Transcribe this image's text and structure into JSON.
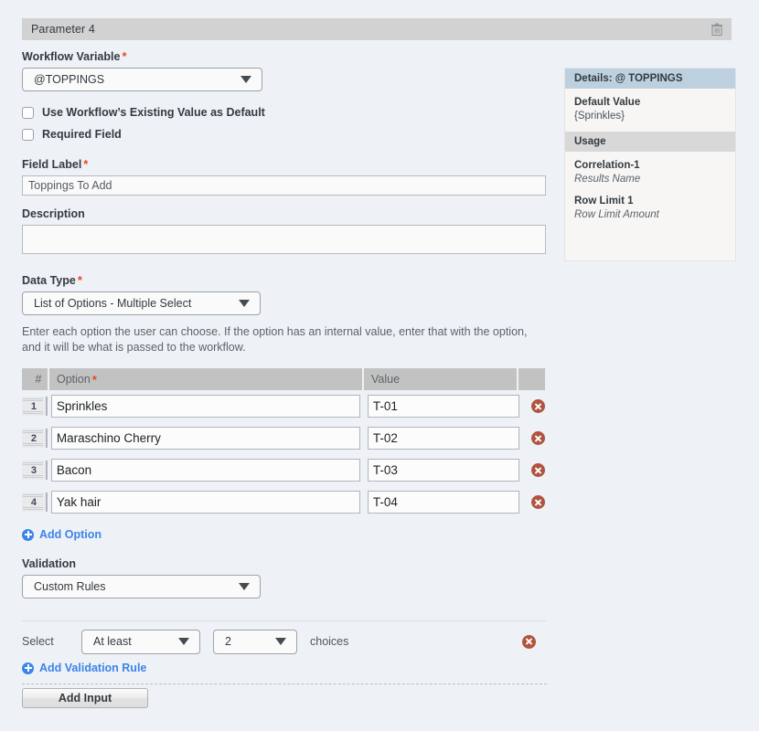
{
  "param_header": {
    "title": "Parameter 4",
    "delete_icon": "trash-icon"
  },
  "form": {
    "workflow_variable": {
      "label": "Workflow Variable",
      "required_marker": "*",
      "value": "@TOPPINGS"
    },
    "checkboxes": [
      {
        "label": "Use Workflow’s Existing Value as Default",
        "checked": false
      },
      {
        "label": "Required Field",
        "checked": false
      }
    ],
    "field_label": {
      "label": "Field Label",
      "required_marker": "*",
      "value": "Toppings To Add"
    },
    "description": {
      "label": "Description",
      "value": ""
    },
    "data_type": {
      "label": "Data Type",
      "required_marker": "*",
      "value": "List of Options - Multiple Select"
    },
    "help_text": "Enter each option the user can choose. If the option has an internal value, enter that with the option, and it will be what is passed to the workflow."
  },
  "options_table": {
    "headers": {
      "num": "#",
      "option": "Option",
      "option_required": "*",
      "value": "Value",
      "actions": ""
    },
    "rows": [
      {
        "num": "1",
        "option": "Sprinkles",
        "value": "T-01"
      },
      {
        "num": "2",
        "option": "Maraschino Cherry",
        "value": "T-02"
      },
      {
        "num": "3",
        "option": "Bacon",
        "value": "T-03"
      },
      {
        "num": "4",
        "option": "Yak hair",
        "value": "T-04"
      }
    ],
    "add_option_label": "Add Option"
  },
  "validation": {
    "label": "Validation",
    "mode": "Custom Rules",
    "rule": {
      "prefix": "Select",
      "operator": "At least",
      "count": "2",
      "suffix": "choices"
    },
    "add_rule_label": "Add Validation Rule"
  },
  "footer": {
    "add_input_label": "Add Input"
  },
  "details_panel": {
    "title": "Details: @ TOPPINGS",
    "default_value_label": "Default Value",
    "default_value": "{Sprinkles}",
    "usage_header": "Usage",
    "usage": [
      {
        "name": "Correlation-1",
        "role": "Results Name"
      },
      {
        "name": "Row Limit 1",
        "role": "Row Limit Amount"
      }
    ]
  },
  "colors": {
    "page_background": "#eef2f6",
    "header_bar": "#d2d2d2",
    "accent_blue": "#3c84e8",
    "required_red": "#e8491d",
    "delete_red": "#b1543f",
    "details_title_bar": "#bdd0df",
    "details_section_bar": "#d8d8d8",
    "table_header": "#c2c2c2"
  }
}
